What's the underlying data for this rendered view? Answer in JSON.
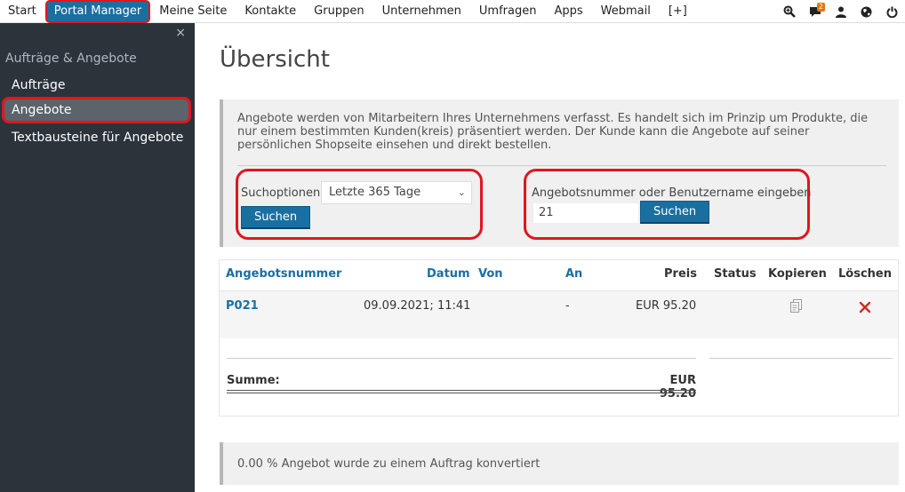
{
  "topnav": {
    "items": [
      "Start",
      "Portal Manager",
      "Meine Seite",
      "Kontakte",
      "Gruppen",
      "Unternehmen",
      "Umfragen",
      "Apps",
      "Webmail",
      "[+]"
    ],
    "active_index": 1,
    "message_count": "2"
  },
  "sidebar": {
    "close": "×",
    "section_title": "Aufträge & Angebote",
    "items": [
      "Aufträge",
      "Angebote",
      "Textbausteine für Angebote"
    ],
    "active_index": 1
  },
  "main": {
    "title": "Übersicht",
    "info_text": "Angebote werden von Mitarbeitern Ihres Unternehmens verfasst. Es handelt sich im Prinzip um Produkte, die nur einem bestimmten Kunden(kreis) präsentiert werden. Der Kunde kann die Angebote auf seiner persönlichen Shopseite einsehen und direkt bestellen.",
    "search_options_label": "Suchoptionen",
    "search_options_value": "Letzte 365 Tage",
    "search_button": "Suchen",
    "number_label": "Angebotsnummer oder Benutzername eingeben",
    "number_value": "21",
    "number_button": "Suchen"
  },
  "table": {
    "headers": {
      "number": "Angebotsnummer",
      "date": "Datum",
      "from": "Von",
      "to": "An",
      "price": "Preis",
      "status": "Status",
      "copy": "Kopieren",
      "delete": "Löschen"
    },
    "rows": [
      {
        "number": "P021",
        "date": "09.09.2021; 11:41",
        "from": "",
        "to": "-",
        "price": "EUR 95.20",
        "status": ""
      }
    ],
    "sum_label": "Summe:",
    "sum_value": "EUR 95.20"
  },
  "footer": {
    "text": "0.00 % Angebot wurde zu einem Auftrag konvertiert"
  },
  "colors": {
    "accent": "#1a6fa1",
    "highlight": "#e0161e",
    "sidebar": "#2b333b",
    "badge": "#e8740c"
  },
  "icons": [
    "search-zoom-icon",
    "messages-icon",
    "user-icon",
    "globe-icon",
    "power-icon",
    "copy-icon",
    "delete-icon",
    "close-icon",
    "chevron-down-icon"
  ]
}
